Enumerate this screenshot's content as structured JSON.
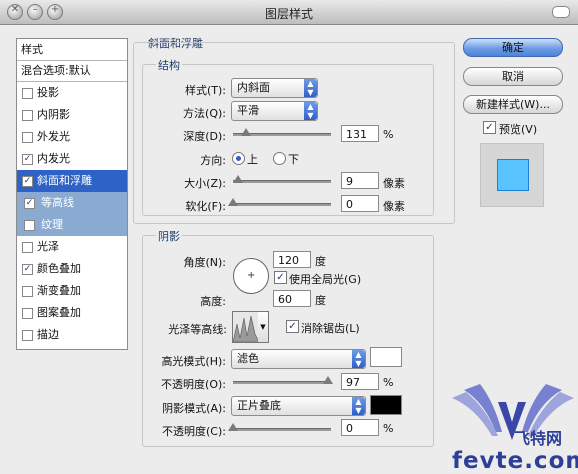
{
  "window": {
    "title": "图层样式"
  },
  "sidebar": {
    "header": "样式",
    "blending": "混合选项:默认",
    "items": [
      {
        "label": "投影",
        "checked": false
      },
      {
        "label": "内阴影",
        "checked": false
      },
      {
        "label": "外发光",
        "checked": false
      },
      {
        "label": "内发光",
        "checked": true
      },
      {
        "label": "斜面和浮雕",
        "checked": true,
        "selected": true
      },
      {
        "label": "等高线",
        "checked": true,
        "sub": true
      },
      {
        "label": "纹理",
        "checked": false,
        "sub": true
      },
      {
        "label": "光泽",
        "checked": false
      },
      {
        "label": "颜色叠加",
        "checked": true
      },
      {
        "label": "渐变叠加",
        "checked": false
      },
      {
        "label": "图案叠加",
        "checked": false
      },
      {
        "label": "描边",
        "checked": false
      }
    ]
  },
  "bevel": {
    "section_title": "斜面和浮雕",
    "structure_title": "结构",
    "style_label": "样式(T):",
    "style_value": "内斜面",
    "technique_label": "方法(Q):",
    "technique_value": "平滑",
    "depth_label": "深度(D):",
    "depth_value": "131",
    "depth_unit": "%",
    "depth_level": 0.13,
    "direction_label": "方向:",
    "direction_up": "上",
    "direction_down": "下",
    "size_label": "大小(Z):",
    "size_value": "9",
    "size_unit": "像素",
    "size_level": 0.05,
    "soften_label": "软化(F):",
    "soften_value": "0",
    "soften_unit": "像素",
    "soften_level": 0
  },
  "shading": {
    "title": "阴影",
    "angle_label": "角度(N):",
    "angle_value": "120",
    "angle_unit": "度",
    "global_light_label": "使用全局光(G)",
    "global_light": true,
    "altitude_label": "高度:",
    "altitude_value": "60",
    "altitude_unit": "度",
    "gloss_label": "光泽等高线:",
    "antialias_label": "消除锯齿(L)",
    "antialias": true,
    "highlight_mode_label": "高光模式(H):",
    "highlight_mode_value": "滤色",
    "highlight_color": "#ffffff",
    "highlight_opacity_label": "不透明度(O):",
    "highlight_opacity_value": "97",
    "highlight_opacity_unit": "%",
    "highlight_opacity_level": 0.97,
    "shadow_mode_label": "阴影模式(A):",
    "shadow_mode_value": "正片叠底",
    "shadow_color": "#000000",
    "shadow_opacity_label": "不透明度(C):",
    "shadow_opacity_value": "0",
    "shadow_opacity_unit": "%",
    "shadow_opacity_level": 0
  },
  "buttons": {
    "ok": "确定",
    "cancel": "取消",
    "new_style": "新建样式(W)...",
    "preview_label": "预览(V)",
    "preview_checked": true
  },
  "watermark": {
    "line1": "飞特网",
    "line2": "fevte.com"
  }
}
